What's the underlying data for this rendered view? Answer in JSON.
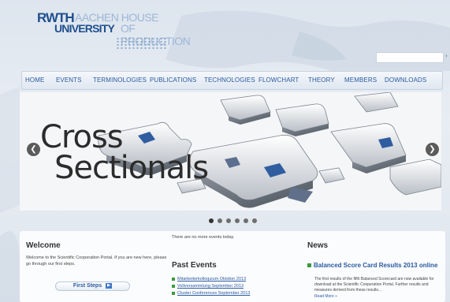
{
  "header": {
    "logo_rwth": "RWTH",
    "logo_aachen": "AACHEN HOUSE",
    "logo_university": "UNIVERSITY",
    "logo_of_production": "OF PRODUCTION"
  },
  "search": {
    "value": "",
    "placeholder": ""
  },
  "nav": {
    "items": [
      {
        "label": "HOME"
      },
      {
        "label": "EVENTS"
      },
      {
        "label": "TERMINOLOGIES"
      },
      {
        "label": "PUBLICATIONS"
      },
      {
        "label": "TECHNOLOGIES"
      },
      {
        "label": "FLOWCHART"
      },
      {
        "label": "THEORY"
      },
      {
        "label": "MEMBERS"
      },
      {
        "label": "DOWNLOADS"
      }
    ]
  },
  "slider": {
    "line1": "Cross",
    "line2": "Sectionals",
    "prev_icon": "chevron-left-icon",
    "next_icon": "chevron-right-icon",
    "dot_count": 6,
    "active_dot": 0
  },
  "welcome": {
    "title": "Welcome",
    "text": "Welcome to the Scientific Cooperation Portal. If you are new here, please go through our first steps.",
    "button_label": "First Steps",
    "button_icon": "play-icon"
  },
  "events": {
    "no_events": "There are no more events today.",
    "past_title": "Past Events",
    "past_items": [
      {
        "label": "Mitarbeiterkolloquium Oktober 2013"
      },
      {
        "label": "Vollversammlung September 2013"
      },
      {
        "label": "Cluster Conferences September 2013"
      }
    ]
  },
  "news": {
    "title": "News",
    "headline": "Balanced Score Card Results 2013 online",
    "body": "The first results of the fifth Balanced Scorecard are now available for download at the Scientific Cooperation Portal. Further results and measures derived from these results...",
    "more": "Read More »"
  },
  "colors": {
    "link": "#2a5aa0",
    "accent_green": "#3c9a3c",
    "logo_dark": "#1f4f8e",
    "logo_light": "#9db7d6"
  }
}
